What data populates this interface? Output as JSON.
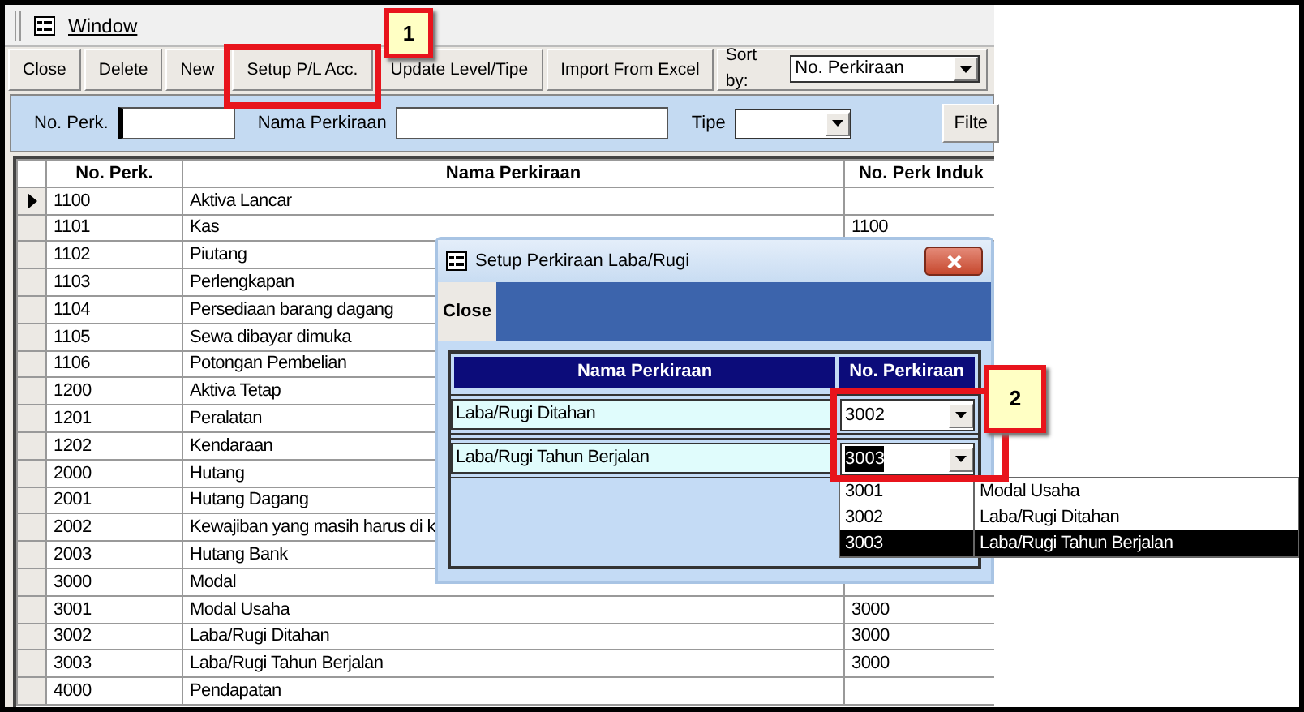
{
  "window": {
    "title": "Window"
  },
  "toolbar": {
    "buttons": [
      {
        "label": "Close"
      },
      {
        "label": "Delete"
      },
      {
        "label": "New"
      },
      {
        "label": "Setup P/L Acc."
      },
      {
        "label": "Update Level/Tipe"
      },
      {
        "label": "Import From Excel"
      }
    ],
    "sort": {
      "label": "Sort by:",
      "value": "No. Perkiraan"
    }
  },
  "filter": {
    "fields": [
      {
        "label": "No. Perk.",
        "kind": "text"
      },
      {
        "label": "Nama Perkiraan",
        "kind": "text"
      },
      {
        "label": "Tipe",
        "kind": "select"
      }
    ],
    "button": "Filte"
  },
  "table": {
    "columns": [
      "No. Perk.",
      "Nama Perkiraan",
      "No. Perk Induk"
    ],
    "rows": [
      {
        "no": "1100",
        "name": "Aktiva Lancar",
        "parent": "",
        "current": true
      },
      {
        "no": "1101",
        "name": "Kas",
        "parent": "1100",
        "current": false
      },
      {
        "no": "1102",
        "name": "Piutang",
        "parent": "",
        "current": false
      },
      {
        "no": "1103",
        "name": "Perlengkapan",
        "parent": "",
        "current": false
      },
      {
        "no": "1104",
        "name": "Persediaan barang dagang",
        "parent": "",
        "current": false
      },
      {
        "no": "1105",
        "name": "Sewa dibayar dimuka",
        "parent": "",
        "current": false
      },
      {
        "no": "1106",
        "name": "Potongan Pembelian",
        "parent": "",
        "current": false
      },
      {
        "no": "1200",
        "name": "Aktiva Tetap",
        "parent": "",
        "current": false
      },
      {
        "no": "1201",
        "name": "Peralatan",
        "parent": "",
        "current": false
      },
      {
        "no": "1202",
        "name": "Kendaraan",
        "parent": "",
        "current": false
      },
      {
        "no": "2000",
        "name": "Hutang",
        "parent": "",
        "current": false
      },
      {
        "no": "2001",
        "name": "Hutang Dagang",
        "parent": "",
        "current": false
      },
      {
        "no": "2002",
        "name": "Kewajiban yang masih harus di k",
        "parent": "",
        "current": false
      },
      {
        "no": "2003",
        "name": "Hutang Bank",
        "parent": "",
        "current": false
      },
      {
        "no": "3000",
        "name": "Modal",
        "parent": "",
        "current": false
      },
      {
        "no": "3001",
        "name": "Modal Usaha",
        "parent": "3000",
        "current": false
      },
      {
        "no": "3002",
        "name": "Laba/Rugi Ditahan",
        "parent": "3000",
        "current": false
      },
      {
        "no": "3003",
        "name": "Laba/Rugi Tahun Berjalan",
        "parent": "3000",
        "current": false
      },
      {
        "no": "4000",
        "name": "Pendapatan",
        "parent": "",
        "current": false
      }
    ]
  },
  "dialog": {
    "title": "Setup Perkiraan Laba/Rugi",
    "button": "Close",
    "columns": [
      "Nama Perkiraan",
      "No. Perkiraan"
    ],
    "rows": [
      {
        "name": "Laba/Rugi Ditahan",
        "value": "3002",
        "focused": false
      },
      {
        "name": "Laba/Rugi Tahun Berjalan",
        "value": "3003",
        "focused": true
      }
    ],
    "dropdown": [
      {
        "code": "3001",
        "name": "Modal Usaha",
        "selected": false
      },
      {
        "code": "3002",
        "name": "Laba/Rugi Ditahan",
        "selected": false
      },
      {
        "code": "3003",
        "name": "Laba/Rugi Tahun Berjalan",
        "selected": true
      }
    ]
  },
  "callouts": [
    {
      "label": "1"
    },
    {
      "label": "2"
    }
  ]
}
